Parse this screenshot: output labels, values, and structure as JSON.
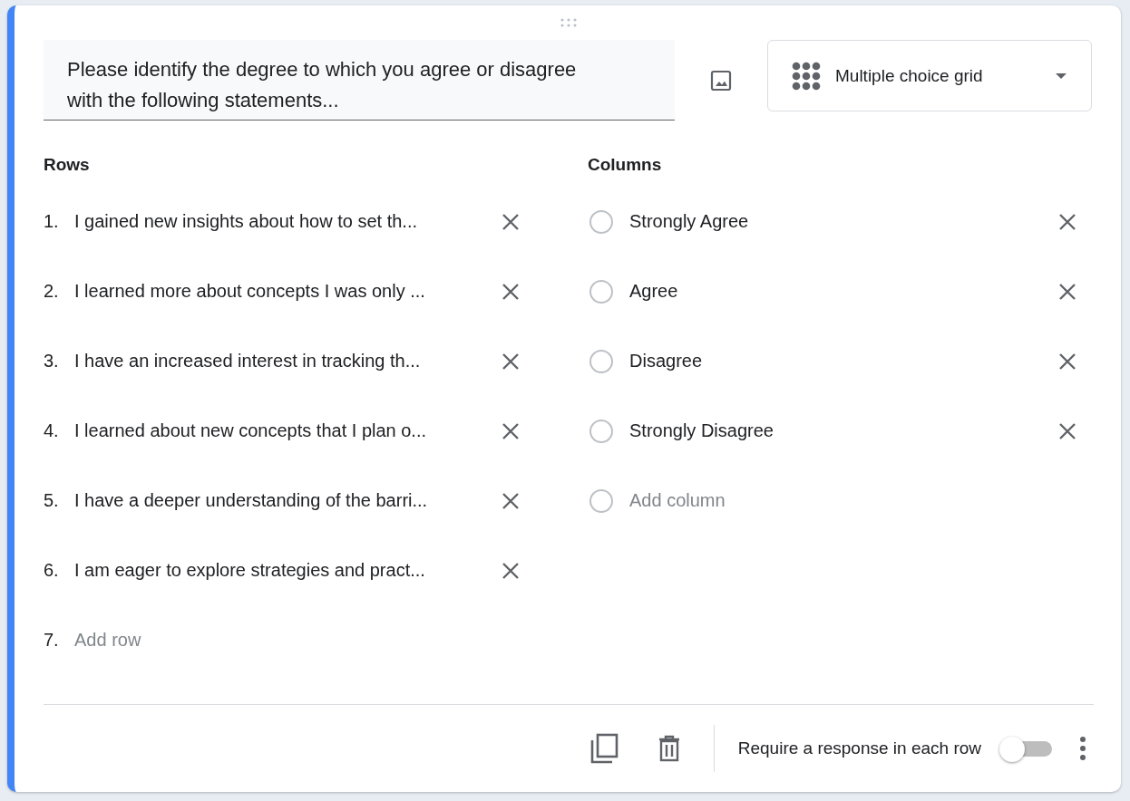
{
  "question": {
    "title": "Please identify the degree to which you agree or disagree with the following statements...",
    "type": "Multiple choice grid"
  },
  "rows_heading": "Rows",
  "rows": [
    {
      "number": "1.",
      "text": "I gained new insights about how to set th..."
    },
    {
      "number": "2.",
      "text": "I learned more about concepts I was only ..."
    },
    {
      "number": "3.",
      "text": "I have an increased interest in tracking th..."
    },
    {
      "number": "4.",
      "text": "I learned about new concepts that I plan o..."
    },
    {
      "number": "5.",
      "text": "I have a deeper understanding of the barri..."
    },
    {
      "number": "6.",
      "text": "I am eager to explore strategies and pract..."
    }
  ],
  "add_row": {
    "number": "7.",
    "label": "Add row"
  },
  "columns_heading": "Columns",
  "columns": [
    {
      "text": "Strongly Agree"
    },
    {
      "text": "Agree"
    },
    {
      "text": "Disagree"
    },
    {
      "text": "Strongly Disagree"
    }
  ],
  "add_column": "Add column",
  "footer": {
    "required_label": "Require a response in each row",
    "required": false
  }
}
